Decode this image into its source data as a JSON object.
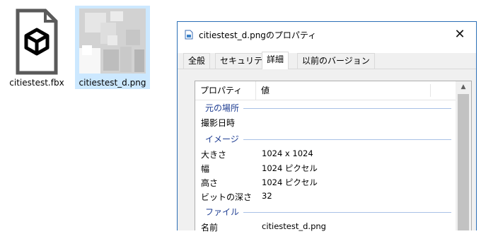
{
  "desktop": {
    "files": [
      {
        "label": "citiestest.fbx",
        "icon": "fbx-file-icon"
      },
      {
        "label": "citiestest_d.png",
        "icon": "png-thumbnail"
      }
    ]
  },
  "dialog": {
    "title": "citiestest_d.pngのプロパティ",
    "title_icon": "image-file-icon",
    "close_icon": "close-icon",
    "close_glyph": "✕",
    "tabs": [
      {
        "label": "全般"
      },
      {
        "label": "セキュリティ"
      },
      {
        "label": "詳細",
        "active": true
      },
      {
        "label": "以前のバージョン"
      }
    ],
    "columns": {
      "property": "プロパティ",
      "value": "値"
    },
    "groups": {
      "origin": "元の場所",
      "image": "イメージ",
      "file": "ファイル"
    },
    "rows": {
      "date_taken": {
        "key": "撮影日時",
        "value": ""
      },
      "dimensions": {
        "key": "大きさ",
        "value": "1024 x 1024"
      },
      "width": {
        "key": "幅",
        "value": "1024 ピクセル"
      },
      "height": {
        "key": "高さ",
        "value": "1024 ピクセル"
      },
      "bit_depth": {
        "key": "ビットの深さ",
        "value": "32"
      },
      "name": {
        "key": "名前",
        "value": "citiestest_d.png"
      }
    },
    "scroll_up_glyph": "▲"
  },
  "colors": {
    "accent": "#2b6fb6",
    "group_text": "#1e3d92",
    "selection": "#cce8ff"
  }
}
